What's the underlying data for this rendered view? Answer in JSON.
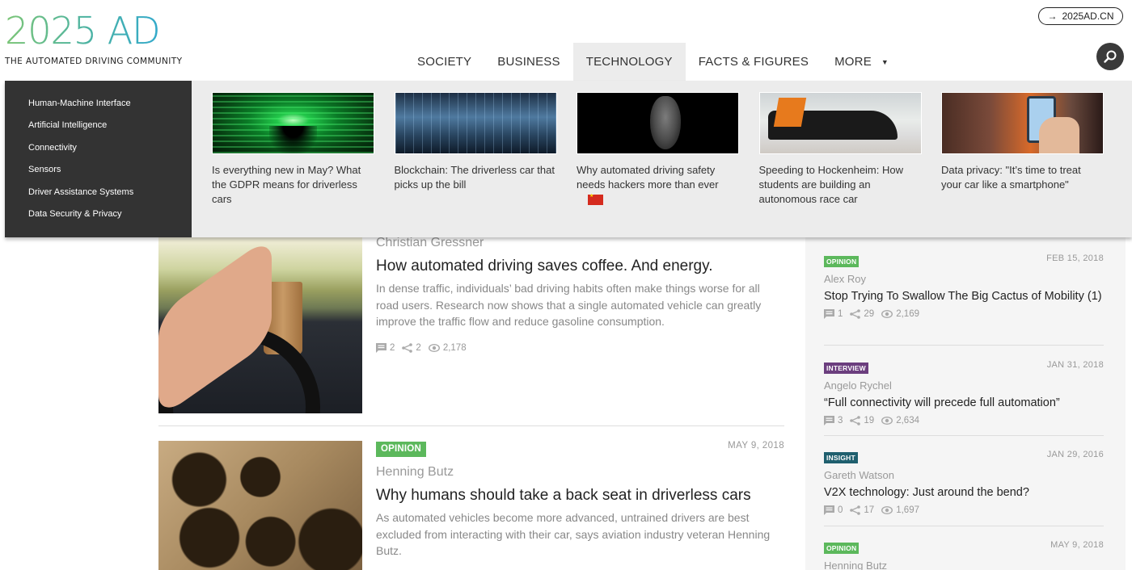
{
  "header": {
    "logo_mark": "2025 AD",
    "logo_tagline": "THE AUTOMATED DRIVING COMMUNITY",
    "cn_link": {
      "icon": "arrow-right-icon",
      "label": "2025AD.CN"
    },
    "search_icon": "search-icon"
  },
  "nav": {
    "items": [
      {
        "label": "SOCIETY",
        "active": false
      },
      {
        "label": "BUSINESS",
        "active": false
      },
      {
        "label": "TECHNOLOGY",
        "active": true
      },
      {
        "label": "FACTS & FIGURES",
        "active": false
      },
      {
        "label": "MORE",
        "active": false,
        "has_dropdown": true
      }
    ]
  },
  "mega_menu": {
    "categories": [
      "Human-Machine Interface",
      "Artificial Intelligence",
      "Connectivity",
      "Sensors",
      "Driver Assistance Systems",
      "Data Security & Privacy"
    ],
    "featured": [
      {
        "title": "Is everything new in May? What the GDPR means for driverless cars",
        "image": "green-binary-tunnel"
      },
      {
        "title": "Blockchain: The driverless car that picks up the bill",
        "image": "digital-car-cockpit"
      },
      {
        "title": "Why automated driving safety needs hackers more than ever",
        "image": "anonymous-mask",
        "flag": "china-flag"
      },
      {
        "title": "Speeding to Hockenheim: How students are building an autonomous race car",
        "image": "formula-student-race-car"
      },
      {
        "title": "Data privacy: \"It’s time to treat your car like a smartphone\"",
        "image": "phone-with-orange-car"
      }
    ]
  },
  "articles": [
    {
      "author": "Christian Gressner",
      "title": "How automated driving saves coffee. And energy.",
      "excerpt": "In dense traffic, individuals’ bad driving habits often make things worse for all road users. Research now shows that a single automated vehicle can greatly improve the traffic flow and reduce gasoline consumption.",
      "comments": "2",
      "shares": "2",
      "views": "2,178",
      "image": "hand-holding-coffee-in-car"
    },
    {
      "badge": "OPINION",
      "badge_color": "#5cb85c",
      "date": "MAY 9, 2018",
      "author": "Henning Butz",
      "title": "Why humans should take a back seat in driverless cars",
      "excerpt": "As automated vehicles become more advanced, untrained drivers are best excluded from interacting with their car, says aviation industry veteran Henning Butz.",
      "image": "vintage-cockpit-gauges"
    }
  ],
  "sidebar": {
    "items": [
      {
        "badge": "OPINION",
        "badge_color": "#5cb85c",
        "date": "FEB 15, 2018",
        "author": "Alex Roy",
        "title": "Stop Trying To Swallow The Big Cactus of Mobility (1)",
        "comments": "1",
        "shares": "29",
        "views": "2,169"
      },
      {
        "badge": "INTERVIEW",
        "badge_color": "#6b3e7e",
        "date": "JAN 31, 2018",
        "author": "Angelo Rychel",
        "title": "“Full connectivity will precede full automation”",
        "comments": "3",
        "shares": "19",
        "views": "2,634"
      },
      {
        "badge": "INSIGHT",
        "badge_color": "#1f5f6e",
        "date": "JAN 29, 2016",
        "author": "Gareth Watson",
        "title": "V2X technology: Just around the bend?",
        "comments": "0",
        "shares": "17",
        "views": "1,697"
      },
      {
        "badge": "OPINION",
        "badge_color": "#5cb85c",
        "date": "MAY 9, 2018",
        "author": "Henning Butz"
      }
    ]
  },
  "colors": {
    "nav_active_bg": "#ececec",
    "mega_sidebar_bg": "#333333",
    "opinion": "#5cb85c",
    "interview": "#6b3e7e",
    "insight": "#1f5f6e"
  }
}
